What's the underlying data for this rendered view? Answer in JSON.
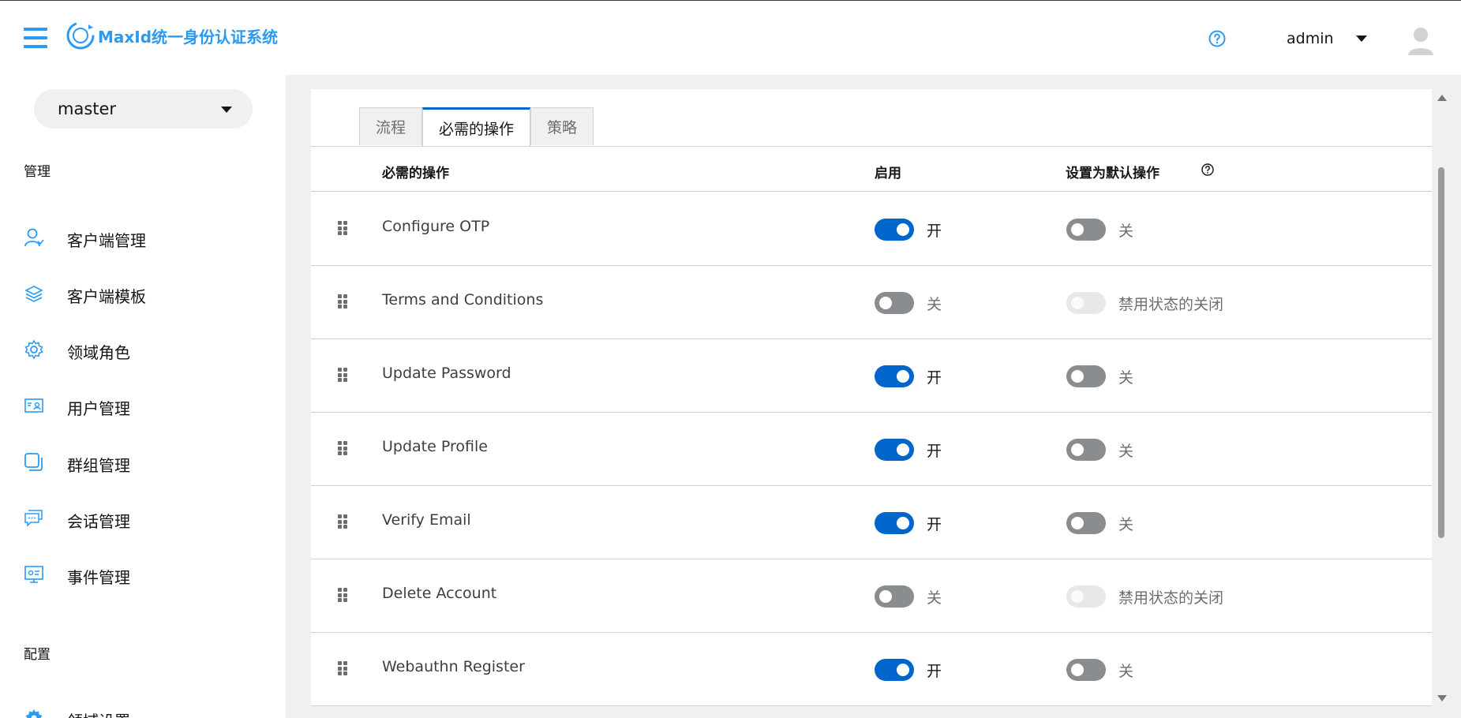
{
  "header": {
    "brand": "MaxId统一身份认证系统",
    "user": "admin"
  },
  "colors": {
    "accent": "#0066cc",
    "brand": "#2b9af3",
    "off": "#8a8d90",
    "disabled": "#e8e8e8"
  },
  "sidebar": {
    "realm": "master",
    "section_manage": "管理",
    "items": [
      {
        "label": "客户端管理",
        "icon": "user-outline-icon"
      },
      {
        "label": "客户端模板",
        "icon": "layers-icon"
      },
      {
        "label": "领域角色",
        "icon": "gear-icon"
      },
      {
        "label": "用户管理",
        "icon": "id-card-icon"
      },
      {
        "label": "群组管理",
        "icon": "group-squares-icon"
      },
      {
        "label": "会话管理",
        "icon": "chat-bubbles-icon"
      },
      {
        "label": "事件管理",
        "icon": "event-screen-icon"
      }
    ],
    "section_config": "配置",
    "partial_item": "领域设置"
  },
  "tabs": [
    "流程",
    "必需的操作",
    "策略"
  ],
  "active_tab": 1,
  "table": {
    "headers": [
      "必需的操作",
      "启用",
      "设置为默认操作"
    ],
    "rows": [
      {
        "name": "Configure OTP",
        "enabled": "on",
        "enabled_label": "开",
        "default": "off",
        "default_label": "关"
      },
      {
        "name": "Terms and Conditions",
        "enabled": "off",
        "enabled_label": "关",
        "default": "disabled",
        "default_label": "禁用状态的关闭"
      },
      {
        "name": "Update Password",
        "enabled": "on",
        "enabled_label": "开",
        "default": "off",
        "default_label": "关"
      },
      {
        "name": "Update Profile",
        "enabled": "on",
        "enabled_label": "开",
        "default": "off",
        "default_label": "关"
      },
      {
        "name": "Verify Email",
        "enabled": "on",
        "enabled_label": "开",
        "default": "off",
        "default_label": "关"
      },
      {
        "name": "Delete Account",
        "enabled": "off",
        "enabled_label": "关",
        "default": "disabled",
        "default_label": "禁用状态的关闭"
      },
      {
        "name": "Webauthn Register",
        "enabled": "on",
        "enabled_label": "开",
        "default": "off",
        "default_label": "关"
      }
    ]
  }
}
